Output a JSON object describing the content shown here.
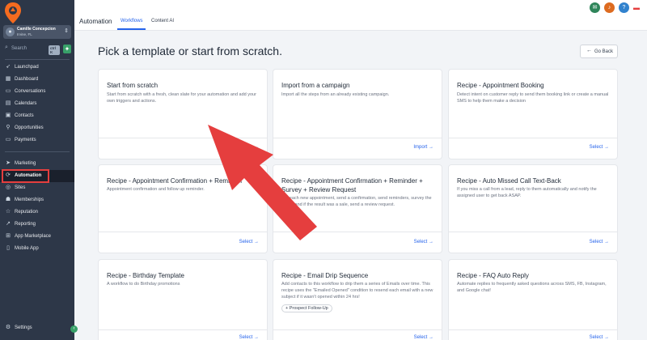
{
  "account": {
    "name": "Camille Concepcion",
    "location": "Irvine, FL"
  },
  "search": {
    "placeholder": "Search",
    "shortcut": "ctrl K"
  },
  "nav": {
    "launchpad": "Launchpad",
    "dashboard": "Dashboard",
    "conversations": "Conversations",
    "calendars": "Calendars",
    "contacts": "Contacts",
    "opportunities": "Opportunities",
    "payments": "Payments",
    "marketing": "Marketing",
    "automation": "Automation",
    "sites": "Sites",
    "memberships": "Memberships",
    "reputation": "Reputation",
    "reporting": "Reporting",
    "app_marketplace": "App Marketplace",
    "mobile_app": "Mobile App",
    "settings": "Settings"
  },
  "topbar": {
    "app_title": "Automation",
    "tabs": [
      "Workflows",
      "Content AI"
    ]
  },
  "colors": {
    "accent": "#2563eb",
    "sidebar": "#2d3748",
    "highlight": "#e53e3e",
    "arrow": "#e53e3e"
  },
  "main": {
    "title": "Pick a template or start from scratch.",
    "go_back": "Go Back",
    "cards": [
      {
        "title": "Start from scratch",
        "desc": "Start from scratch with a fresh, clean slate for your automation and add your own triggers and actions.",
        "action": "Continue"
      },
      {
        "title": "Import from a campaign",
        "desc": "Import all the steps from an already existing campaign.",
        "action": "Import"
      },
      {
        "title": "Recipe - Appointment Booking",
        "desc": "Detect intent on customer reply to send them booking link or create a manual SMS to help them make a decision",
        "action": "Select"
      },
      {
        "title": "Recipe - Appointment Confirmation + Reminder",
        "desc": "Appointment confirmation and follow up reminder.",
        "action": "Select"
      },
      {
        "title": "Recipe - Appointment Confirmation + Reminder + Survey + Review Request",
        "desc": "For each new appointment, send a confirmation, send reminders, survey the result, and if the result was a sale, send a review request.",
        "action": "Select"
      },
      {
        "title": "Recipe - Auto Missed Call Text-Back",
        "desc": "If you miss a call from a lead, reply to them automatically and notify the assigned user to get back ASAP.",
        "action": "Select"
      },
      {
        "title": "Recipe - Birthday Template",
        "desc": "A workflow to do Birthday promotions",
        "action": "Select"
      },
      {
        "title": "Recipe - Email Drip Sequence",
        "desc": "Add contacts to this workflow to drip them a series of Emails over time. This recipe uses the \"Emailed Opened\" condition to resend each email with a new subject if it wasn't opened within 24 hrs!",
        "action": "Select",
        "tag": "Prospect Follow-Up"
      },
      {
        "title": "Recipe - FAQ Auto Reply",
        "desc": "Automate replies to frequently asked questions across SMS, FB, Instagram, and Google chat!",
        "action": "Select"
      }
    ]
  }
}
